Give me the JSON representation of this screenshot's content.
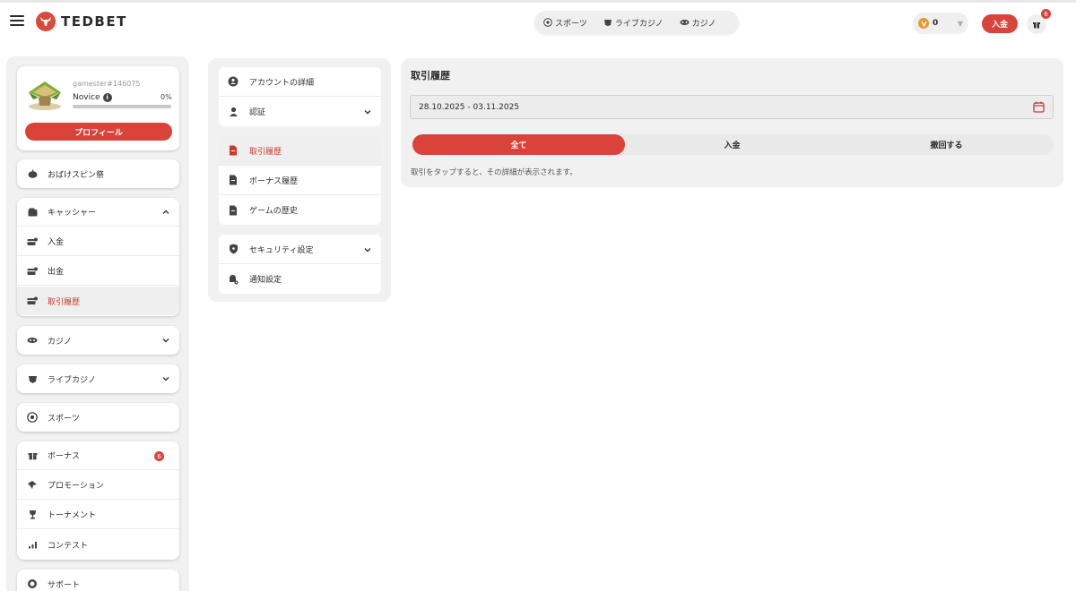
{
  "header": {
    "logo_text": "TEDBET",
    "nav": [
      {
        "label": "スポーツ",
        "icon": "soccer-ball-icon"
      },
      {
        "label": "ライブカジノ",
        "icon": "live-casino-icon"
      },
      {
        "label": "カジノ",
        "icon": "casino-icon"
      }
    ],
    "balance": "0",
    "deposit_label": "入金",
    "gift_count": "6"
  },
  "sidebar": {
    "profile": {
      "username": "gamester#146075",
      "rank": "Novice",
      "progress_label": "0%",
      "progress": 0,
      "button_label": "プロフィール"
    },
    "spin_fest": "おばけスピン祭",
    "cashier": {
      "label": "キャッシャー",
      "items": [
        "入金",
        "出金",
        "取引履歴"
      ],
      "active": "取引履歴"
    },
    "casino": "カジノ",
    "live_casino": "ライブカジノ",
    "sports": "スポーツ",
    "bonus_group": {
      "bonus": "ボーナス",
      "bonus_count": "6",
      "promotion": "プロモーション",
      "tournament": "トーナメント",
      "contest": "コンテスト"
    },
    "support": "サポート"
  },
  "account_menu": {
    "group1": [
      "アカウントの詳細",
      "認証"
    ],
    "group2": [
      "取引履歴",
      "ボーナス履歴",
      "ゲームの歴史"
    ],
    "group3": [
      "セキュリティ設定",
      "通知設定"
    ],
    "active": "取引履歴"
  },
  "main": {
    "title": "取引履歴",
    "date_range": "28.10.2025 - 03.11.2025",
    "tabs": [
      "全て",
      "入金",
      "撤回する"
    ],
    "active_tab": "全て",
    "hint": "取引をタップすると、その詳細が表示されます。"
  },
  "colors": {
    "accent": "#d9433a",
    "panel": "#f1f1f1",
    "active_text": "#c9392f"
  }
}
